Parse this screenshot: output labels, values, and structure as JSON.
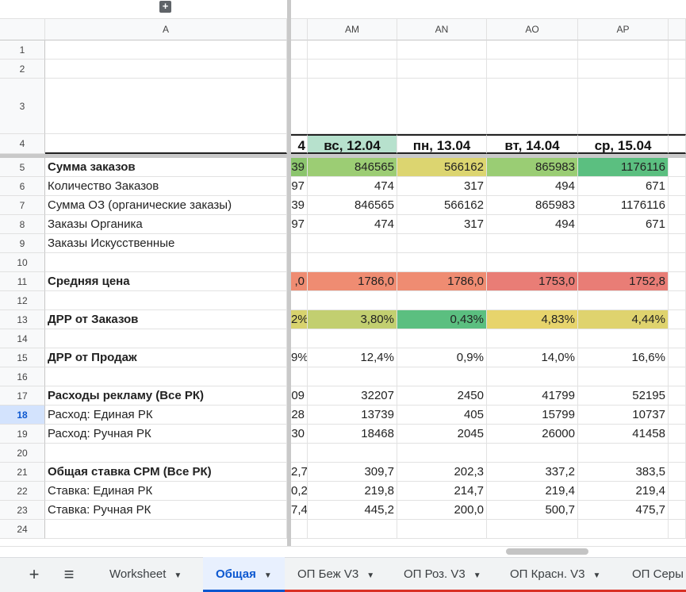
{
  "group_toggle": "+",
  "columns": [
    {
      "key": "A",
      "label": "A"
    },
    {
      "key": "AM",
      "label": "AM"
    },
    {
      "key": "AN",
      "label": "AN"
    },
    {
      "key": "AO",
      "label": "AO"
    },
    {
      "key": "AP",
      "label": "AP"
    }
  ],
  "row_numbers": [
    "1",
    "2",
    "3",
    "4",
    "5",
    "6",
    "7",
    "8",
    "9",
    "10",
    "11",
    "12",
    "13",
    "14",
    "15",
    "16",
    "17",
    "18",
    "19",
    "20",
    "21",
    "22",
    "23",
    "24"
  ],
  "selected_row": "18",
  "dates": {
    "partial": "4",
    "am": "вс, 12.04",
    "an": "пн, 13.04",
    "ao": "вт, 14.04",
    "ap": "ср, 15.04"
  },
  "rows": [
    {
      "n": "5",
      "label": "Сумма заказов",
      "bold": true,
      "partial": "39",
      "am": "846565",
      "an": "566162",
      "ao": "865983",
      "ap": "1176116",
      "fill": {
        "partial": "#8bc56d",
        "am": "#9ccd74",
        "an": "#dcd570",
        "ao": "#9acd74",
        "ap": "#5bbf80"
      }
    },
    {
      "n": "6",
      "label": "Количество Заказов",
      "bold": false,
      "partial": "97",
      "am": "474",
      "an": "317",
      "ao": "494",
      "ap": "671"
    },
    {
      "n": "7",
      "label": "Сумма ОЗ (органические заказы)",
      "bold": false,
      "partial": "39",
      "am": "846565",
      "an": "566162",
      "ao": "865983",
      "ap": "1176116"
    },
    {
      "n": "8",
      "label": "Заказы Органика",
      "bold": false,
      "partial": "97",
      "am": "474",
      "an": "317",
      "ao": "494",
      "ap": "671"
    },
    {
      "n": "9",
      "label": "Заказы Искусственные",
      "bold": false,
      "partial": "",
      "am": "",
      "an": "",
      "ao": "",
      "ap": ""
    },
    {
      "n": "10",
      "label": "",
      "bold": false,
      "partial": "",
      "am": "",
      "an": "",
      "ao": "",
      "ap": ""
    },
    {
      "n": "11",
      "label": "Средняя цена",
      "bold": true,
      "partial": ",0",
      "am": "1786,0",
      "an": "1786,0",
      "ao": "1753,0",
      "ap": "1752,8",
      "fill": {
        "partial": "#ef8c72",
        "am": "#ef8c72",
        "an": "#ef8c72",
        "ao": "#e97d76",
        "ap": "#e97d76"
      }
    },
    {
      "n": "12",
      "label": "",
      "bold": false,
      "partial": "",
      "am": "",
      "an": "",
      "ao": "",
      "ap": ""
    },
    {
      "n": "13",
      "label": "ДРР от Заказов",
      "bold": true,
      "partial": "2%",
      "am": "3,80%",
      "an": "0,43%",
      "ao": "4,83%",
      "ap": "4,44%",
      "fill": {
        "partial": "#d8d36e",
        "am": "#c2cf70",
        "an": "#5bbf80",
        "ao": "#e7d46c",
        "ap": "#dfd36e"
      }
    },
    {
      "n": "14",
      "label": "",
      "bold": false,
      "partial": "",
      "am": "",
      "an": "",
      "ao": "",
      "ap": ""
    },
    {
      "n": "15",
      "label": "ДРР от Продаж",
      "bold": true,
      "partial": "9%",
      "am": "12,4%",
      "an": "0,9%",
      "ao": "14,0%",
      "ap": "16,6%"
    },
    {
      "n": "16",
      "label": "",
      "bold": false,
      "partial": "",
      "am": "",
      "an": "",
      "ao": "",
      "ap": ""
    },
    {
      "n": "17",
      "label": "Расходы рекламу (Все РК)",
      "bold": true,
      "partial": "09",
      "am": "32207",
      "an": "2450",
      "ao": "41799",
      "ap": "52195"
    },
    {
      "n": "18",
      "label": "Расход: Единая РК",
      "bold": false,
      "partial": "28",
      "am": "13739",
      "an": "405",
      "ao": "15799",
      "ap": "10737"
    },
    {
      "n": "19",
      "label": "Расход: Ручная РК",
      "bold": false,
      "partial": "30",
      "am": "18468",
      "an": "2045",
      "ao": "26000",
      "ap": "41458"
    },
    {
      "n": "20",
      "label": "",
      "bold": false,
      "partial": "",
      "am": "",
      "an": "",
      "ao": "",
      "ap": ""
    },
    {
      "n": "21",
      "label": "Общая ставка CPM (Все РК)",
      "bold": true,
      "partial": "2,7",
      "am": "309,7",
      "an": "202,3",
      "ao": "337,2",
      "ap": "383,5"
    },
    {
      "n": "22",
      "label": "Ставка: Единая РК",
      "bold": false,
      "partial": "0,2",
      "am": "219,8",
      "an": "214,7",
      "ao": "219,4",
      "ap": "219,4"
    },
    {
      "n": "23",
      "label": "Ставка: Ручная РК",
      "bold": false,
      "partial": "7,4",
      "am": "445,2",
      "an": "200,0",
      "ao": "500,7",
      "ap": "475,7"
    },
    {
      "n": "24",
      "label": "",
      "bold": false,
      "partial": "",
      "am": "",
      "an": "",
      "ao": "",
      "ap": ""
    }
  ],
  "tabs": {
    "add_icon": "+",
    "menu_icon": "≡",
    "items": [
      {
        "label": "Worksheet",
        "active": false,
        "red": false
      },
      {
        "label": "Общая",
        "active": true,
        "red": false
      },
      {
        "label": "ОП Беж V3",
        "active": false,
        "red": true
      },
      {
        "label": "ОП Роз. V3",
        "active": false,
        "red": true
      },
      {
        "label": "ОП Красн. V3",
        "active": false,
        "red": true
      },
      {
        "label": "ОП Серы",
        "active": false,
        "red": true
      }
    ],
    "dropdown_glyph": "▼"
  }
}
